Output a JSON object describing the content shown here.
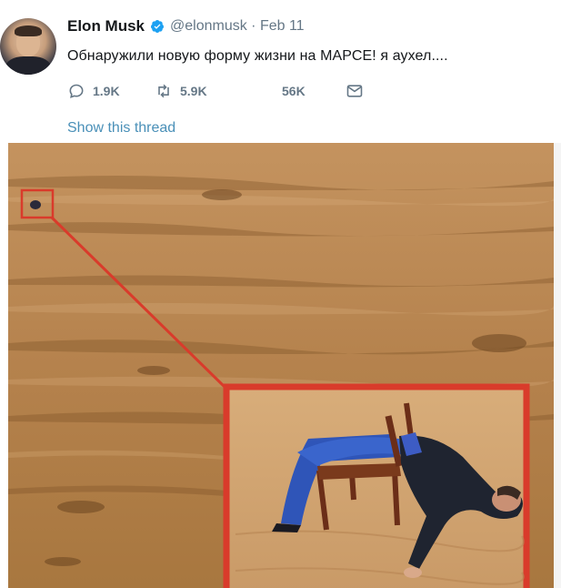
{
  "tweet": {
    "author_name": "Elon Musk",
    "handle": "@elonmusk · Feb 11",
    "text": "Обнаружили новую форму жизни на МАРСЕ! я аухел....",
    "replies": "1.9K",
    "retweets": "5.9K",
    "likes": "56K",
    "show_thread": "Show this thread"
  },
  "icons": {
    "verified": "verified-badge-icon",
    "reply": "reply-icon",
    "retweet": "retweet-icon",
    "like": "heart-icon",
    "dm": "envelope-icon"
  },
  "colors": {
    "verified": "#1da1f2",
    "link": "#4a90b8",
    "secondary": "#657786",
    "highlight_box": "#d93b2b",
    "sand": "#b5824d"
  }
}
